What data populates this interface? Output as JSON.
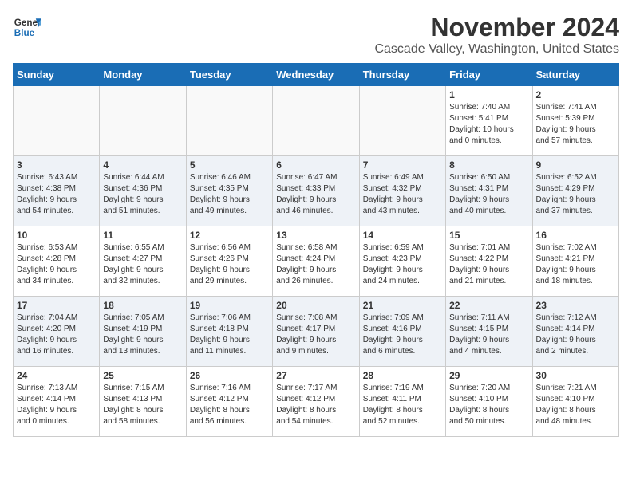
{
  "logo": {
    "text_general": "General",
    "text_blue": "Blue"
  },
  "header": {
    "month": "November 2024",
    "location": "Cascade Valley, Washington, United States"
  },
  "weekdays": [
    "Sunday",
    "Monday",
    "Tuesday",
    "Wednesday",
    "Thursday",
    "Friday",
    "Saturday"
  ],
  "weeks": [
    [
      {
        "day": "",
        "info": ""
      },
      {
        "day": "",
        "info": ""
      },
      {
        "day": "",
        "info": ""
      },
      {
        "day": "",
        "info": ""
      },
      {
        "day": "",
        "info": ""
      },
      {
        "day": "1",
        "info": "Sunrise: 7:40 AM\nSunset: 5:41 PM\nDaylight: 10 hours\nand 0 minutes."
      },
      {
        "day": "2",
        "info": "Sunrise: 7:41 AM\nSunset: 5:39 PM\nDaylight: 9 hours\nand 57 minutes."
      }
    ],
    [
      {
        "day": "3",
        "info": "Sunrise: 6:43 AM\nSunset: 4:38 PM\nDaylight: 9 hours\nand 54 minutes."
      },
      {
        "day": "4",
        "info": "Sunrise: 6:44 AM\nSunset: 4:36 PM\nDaylight: 9 hours\nand 51 minutes."
      },
      {
        "day": "5",
        "info": "Sunrise: 6:46 AM\nSunset: 4:35 PM\nDaylight: 9 hours\nand 49 minutes."
      },
      {
        "day": "6",
        "info": "Sunrise: 6:47 AM\nSunset: 4:33 PM\nDaylight: 9 hours\nand 46 minutes."
      },
      {
        "day": "7",
        "info": "Sunrise: 6:49 AM\nSunset: 4:32 PM\nDaylight: 9 hours\nand 43 minutes."
      },
      {
        "day": "8",
        "info": "Sunrise: 6:50 AM\nSunset: 4:31 PM\nDaylight: 9 hours\nand 40 minutes."
      },
      {
        "day": "9",
        "info": "Sunrise: 6:52 AM\nSunset: 4:29 PM\nDaylight: 9 hours\nand 37 minutes."
      }
    ],
    [
      {
        "day": "10",
        "info": "Sunrise: 6:53 AM\nSunset: 4:28 PM\nDaylight: 9 hours\nand 34 minutes."
      },
      {
        "day": "11",
        "info": "Sunrise: 6:55 AM\nSunset: 4:27 PM\nDaylight: 9 hours\nand 32 minutes."
      },
      {
        "day": "12",
        "info": "Sunrise: 6:56 AM\nSunset: 4:26 PM\nDaylight: 9 hours\nand 29 minutes."
      },
      {
        "day": "13",
        "info": "Sunrise: 6:58 AM\nSunset: 4:24 PM\nDaylight: 9 hours\nand 26 minutes."
      },
      {
        "day": "14",
        "info": "Sunrise: 6:59 AM\nSunset: 4:23 PM\nDaylight: 9 hours\nand 24 minutes."
      },
      {
        "day": "15",
        "info": "Sunrise: 7:01 AM\nSunset: 4:22 PM\nDaylight: 9 hours\nand 21 minutes."
      },
      {
        "day": "16",
        "info": "Sunrise: 7:02 AM\nSunset: 4:21 PM\nDaylight: 9 hours\nand 18 minutes."
      }
    ],
    [
      {
        "day": "17",
        "info": "Sunrise: 7:04 AM\nSunset: 4:20 PM\nDaylight: 9 hours\nand 16 minutes."
      },
      {
        "day": "18",
        "info": "Sunrise: 7:05 AM\nSunset: 4:19 PM\nDaylight: 9 hours\nand 13 minutes."
      },
      {
        "day": "19",
        "info": "Sunrise: 7:06 AM\nSunset: 4:18 PM\nDaylight: 9 hours\nand 11 minutes."
      },
      {
        "day": "20",
        "info": "Sunrise: 7:08 AM\nSunset: 4:17 PM\nDaylight: 9 hours\nand 9 minutes."
      },
      {
        "day": "21",
        "info": "Sunrise: 7:09 AM\nSunset: 4:16 PM\nDaylight: 9 hours\nand 6 minutes."
      },
      {
        "day": "22",
        "info": "Sunrise: 7:11 AM\nSunset: 4:15 PM\nDaylight: 9 hours\nand 4 minutes."
      },
      {
        "day": "23",
        "info": "Sunrise: 7:12 AM\nSunset: 4:14 PM\nDaylight: 9 hours\nand 2 minutes."
      }
    ],
    [
      {
        "day": "24",
        "info": "Sunrise: 7:13 AM\nSunset: 4:14 PM\nDaylight: 9 hours\nand 0 minutes."
      },
      {
        "day": "25",
        "info": "Sunrise: 7:15 AM\nSunset: 4:13 PM\nDaylight: 8 hours\nand 58 minutes."
      },
      {
        "day": "26",
        "info": "Sunrise: 7:16 AM\nSunset: 4:12 PM\nDaylight: 8 hours\nand 56 minutes."
      },
      {
        "day": "27",
        "info": "Sunrise: 7:17 AM\nSunset: 4:12 PM\nDaylight: 8 hours\nand 54 minutes."
      },
      {
        "day": "28",
        "info": "Sunrise: 7:19 AM\nSunset: 4:11 PM\nDaylight: 8 hours\nand 52 minutes."
      },
      {
        "day": "29",
        "info": "Sunrise: 7:20 AM\nSunset: 4:10 PM\nDaylight: 8 hours\nand 50 minutes."
      },
      {
        "day": "30",
        "info": "Sunrise: 7:21 AM\nSunset: 4:10 PM\nDaylight: 8 hours\nand 48 minutes."
      }
    ]
  ]
}
